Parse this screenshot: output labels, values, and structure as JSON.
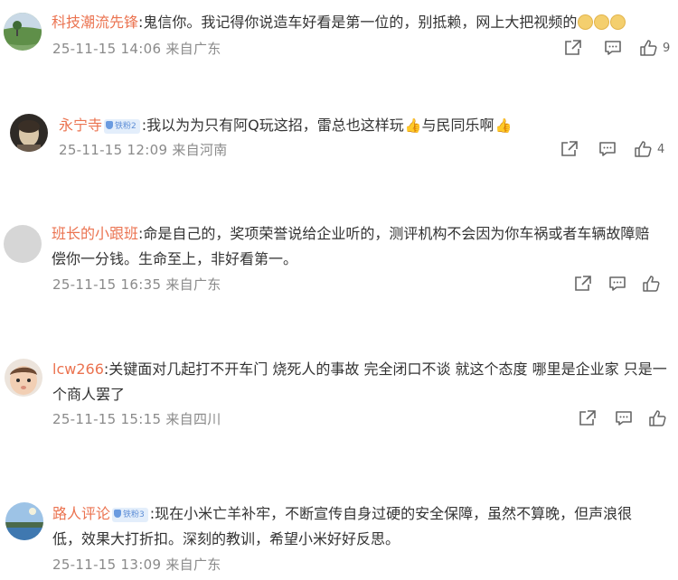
{
  "comments": [
    {
      "user": "科技潮流先锋",
      "text": ":鬼信你。我记得你说造车好看是第一位的，别抵赖，网上大把视频的",
      "line2": "",
      "meta": "25-11-15 14:06 来自广东",
      "likes": "9",
      "badge": "",
      "emoji": [
        "cat-face-emoji",
        "cat-face-emoji",
        "cat-face-emoji"
      ]
    },
    {
      "user": "永宁寺",
      "text": ":我以为为只有阿Q玩这招，雷总也这样玩",
      "text_after": "与民同乐啊",
      "line2": "",
      "meta": "25-11-15 12:09 来自河南",
      "likes": "4",
      "badge": "铁粉2"
    },
    {
      "user": "班长的小跟班",
      "text": ":命是自己的，奖项荣誉说给企业听的，测评机构不会因为你车祸或者车辆故障赔",
      "line2": "偿你一分钱。生命至上，非好看第一。",
      "meta": "25-11-15 16:35 来自广东",
      "likes": "",
      "badge": ""
    },
    {
      "user": "lcw266",
      "text": ":关键面对几起打不开车门 烧死人的事故 完全闭口不谈 就这个态度 哪里是企业家 只是一",
      "line2": "个商人罢了",
      "meta": "25-11-15 15:15 来自四川",
      "likes": "",
      "badge": ""
    },
    {
      "user": "路人评论",
      "text": ":现在小米亡羊补牢，不断宣传自身过硬的安全保障，虽然不算晚，但声浪很",
      "line2": "低，效果大打折扣。深刻的教训，希望小米好好反思。",
      "meta": "25-11-15 13:09 来自广东",
      "likes": "",
      "badge": "铁粉3"
    }
  ],
  "colors": {
    "username": "#eb7350",
    "meta": "#8a8a8a",
    "badge_bg": "#e3eefb"
  },
  "icons": [
    "share-icon",
    "comment-icon",
    "like-icon"
  ]
}
